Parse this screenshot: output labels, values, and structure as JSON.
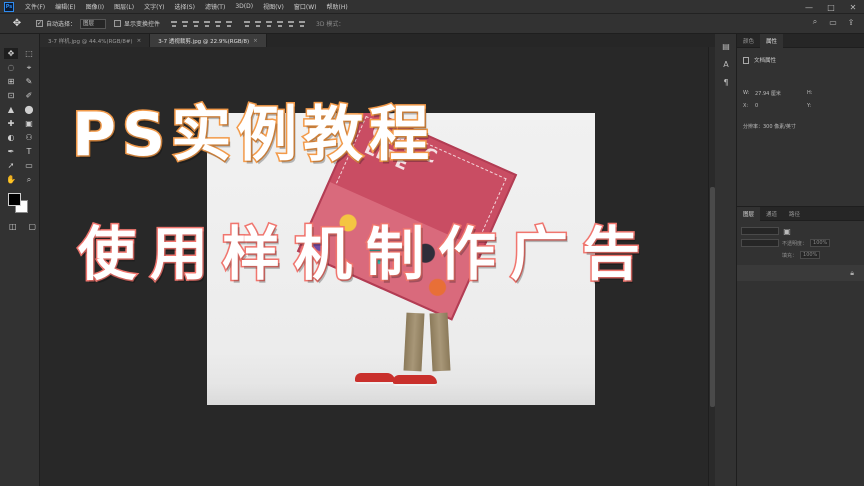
{
  "app": {
    "logo": "Ps",
    "menu": [
      "文件(F)",
      "编辑(E)",
      "图像(I)",
      "图层(L)",
      "文字(Y)",
      "选择(S)",
      "滤镜(T)",
      "3D(D)",
      "视图(V)",
      "窗口(W)",
      "帮助(H)"
    ],
    "window_controls": [
      "—",
      "□",
      "✕"
    ]
  },
  "options_bar": {
    "auto_select_label": "自动选择：",
    "auto_select_value": "图层",
    "transform_label": "显示变换控件",
    "mode_3d_label": "3D 模式："
  },
  "tabs": [
    {
      "label": "3-7 样机.jpg @ 44.4%(RGB/8#)",
      "active": false
    },
    {
      "label": "3-7 透视裁剪.jpg @ 22.9%(RGB/8)",
      "active": true
    }
  ],
  "tools": [
    "✥",
    "⬚",
    "◌",
    "⌖",
    "⊞",
    "✎",
    "⊡",
    "✐",
    "▲",
    "⬤",
    "✚",
    "▣",
    "◐",
    "⚇",
    "✒",
    "T",
    "➚",
    "▭",
    "✋",
    "⌕"
  ],
  "canvas": {
    "title_line1": "PS实例教程",
    "title_line2": "使用样机制作广告",
    "poster_text": "OME C\nLIFE"
  },
  "properties_panel": {
    "tabs": [
      {
        "label": "颜色",
        "active": false
      },
      {
        "label": "属性",
        "active": true
      }
    ],
    "doc_title": "文档属性",
    "w_label": "W:",
    "w_value": "27.94 厘米",
    "h_label": "H:",
    "x_label": "X:",
    "x_value": "0",
    "y_label": "Y:",
    "resolution": "分辨率：300 像素/英寸"
  },
  "layers_panel": {
    "tabs": [
      {
        "label": "图层",
        "active": true
      },
      {
        "label": "通道",
        "active": false
      },
      {
        "label": "路径",
        "active": false
      }
    ],
    "opacity_label": "不透明度：",
    "opacity_value": "100%",
    "fill_label": "填充：",
    "fill_value": "100%"
  },
  "colors": {
    "panel_bg": "#323232",
    "canvas_bg": "#282828",
    "title1_stroke": "#f29a4a",
    "title2_stroke": "#f0766f",
    "accent_blue": "#2f8cf0"
  }
}
